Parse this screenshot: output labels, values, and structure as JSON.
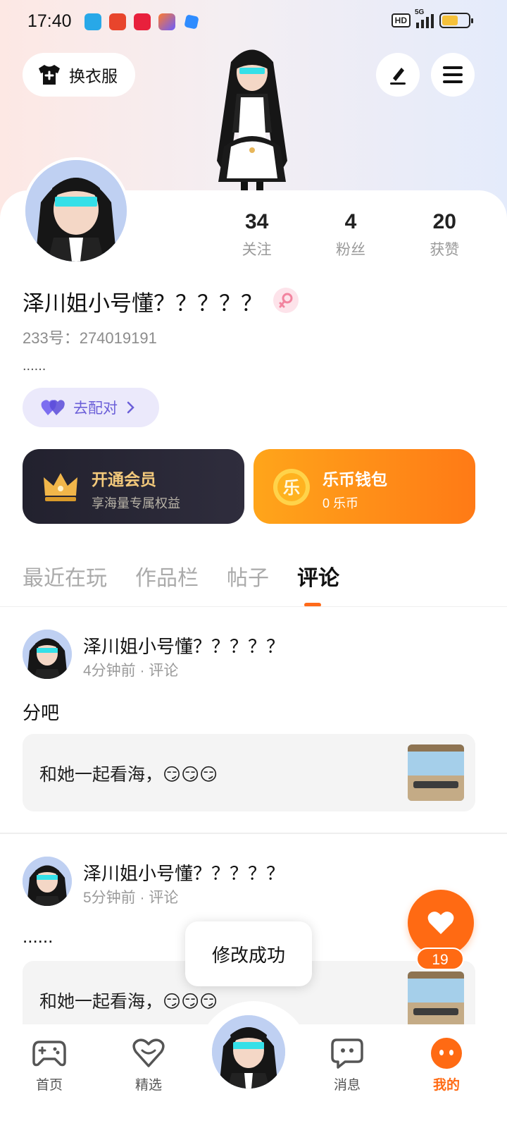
{
  "status_bar": {
    "time": "17:40",
    "network_badge": "HD",
    "network_type": "5G",
    "battery_level": 0.62,
    "app_icons": [
      "blue-app-icon",
      "sohu-app-icon",
      "red-app-icon",
      "gradient-app-icon",
      "blue-square-app-icon"
    ]
  },
  "header": {
    "dress_up_label": "换衣服",
    "edit_icon": "pen-icon",
    "menu_icon": "hamburger-icon"
  },
  "profile": {
    "stats": [
      {
        "value": "34",
        "label": "关注"
      },
      {
        "value": "4",
        "label": "粉丝"
      },
      {
        "value": "20",
        "label": "获赞"
      }
    ],
    "nickname": "泽川姐小号懂？？？？？",
    "gender": "female",
    "uid": "233号：274019191",
    "bio": "......",
    "match_label": "去配对"
  },
  "cards": {
    "vip": {
      "title": "开通会员",
      "subtitle": "享海量专属权益"
    },
    "wallet": {
      "title": "乐币钱包",
      "subtitle": "0 乐币",
      "coin_glyph": "乐"
    }
  },
  "tabs": [
    {
      "label": "最近在玩",
      "active": false
    },
    {
      "label": "作品栏",
      "active": false
    },
    {
      "label": "帖子",
      "active": false
    },
    {
      "label": "评论",
      "active": true
    }
  ],
  "posts": [
    {
      "author": "泽川姐小号懂？？？？？",
      "meta": "4分钟前 · 评论",
      "text": "分吧",
      "quote": "和她一起看海，😏😏😏"
    },
    {
      "author": "泽川姐小号懂？？？？？",
      "meta": "5分钟前 · 评论",
      "text": "......",
      "quote": "和她一起看海，😏😏😏"
    }
  ],
  "like": {
    "count": "19"
  },
  "toast": "修改成功",
  "bottom_nav": {
    "items": [
      {
        "label": "首页",
        "icon": "gamepad-icon"
      },
      {
        "label": "精选",
        "icon": "heart-outline-icon"
      },
      {
        "label": "消息",
        "icon": "chat-bubble-icon"
      },
      {
        "label": "我的",
        "icon": "face-icon",
        "active": true
      }
    ]
  },
  "colors": {
    "accent": "#ff6a13",
    "vip_gold": "#f3c97b",
    "match_purple": "#6b5fd8"
  }
}
